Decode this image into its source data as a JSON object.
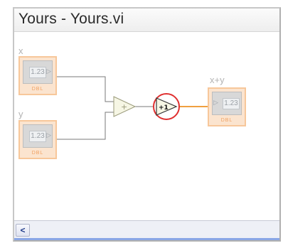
{
  "window": {
    "title": "Yours - Yours.vi"
  },
  "diagram": {
    "terminals": [
      {
        "label": "x",
        "value": "1.23",
        "type": "DBL"
      },
      {
        "label": "y",
        "value": "1.23",
        "type": "DBL"
      },
      {
        "label": "x+y",
        "value": "1.23",
        "type": "DBL"
      }
    ],
    "add_node": {
      "symbol": "+"
    },
    "increment_node": {
      "symbol": "+1"
    }
  },
  "colors": {
    "wire_numeric": "#f0a040",
    "highlight": "#e03030"
  },
  "scrollbar": {
    "left_arrow": "<"
  }
}
